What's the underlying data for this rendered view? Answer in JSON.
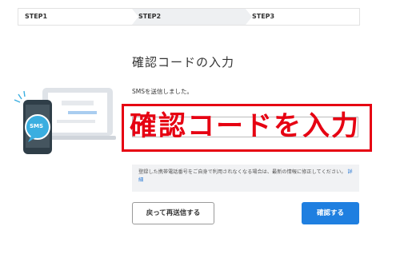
{
  "stepper": {
    "steps": [
      {
        "label": "STEP1"
      },
      {
        "label": "STEP2"
      },
      {
        "label": "STEP3"
      }
    ],
    "active_index": 1
  },
  "main": {
    "title": "確認コードの入力",
    "sms_sent": "SMSを送信しました。",
    "overlay_text": "確認コードを入力",
    "code_input": {
      "value": "",
      "placeholder": ""
    },
    "info": {
      "text": "登録した携帯電話番号をご自身で利用されなくなる場合は、最新の情報に修正してください。",
      "link": "詳細"
    },
    "buttons": {
      "back": "戻って再送信する",
      "confirm": "確認する"
    }
  },
  "illustration": {
    "badge": "SMS"
  },
  "colors": {
    "accent": "#1f7fe0",
    "highlight_red": "#e60012",
    "phone": "#2f3e48",
    "bubble": "#3aaee0"
  }
}
